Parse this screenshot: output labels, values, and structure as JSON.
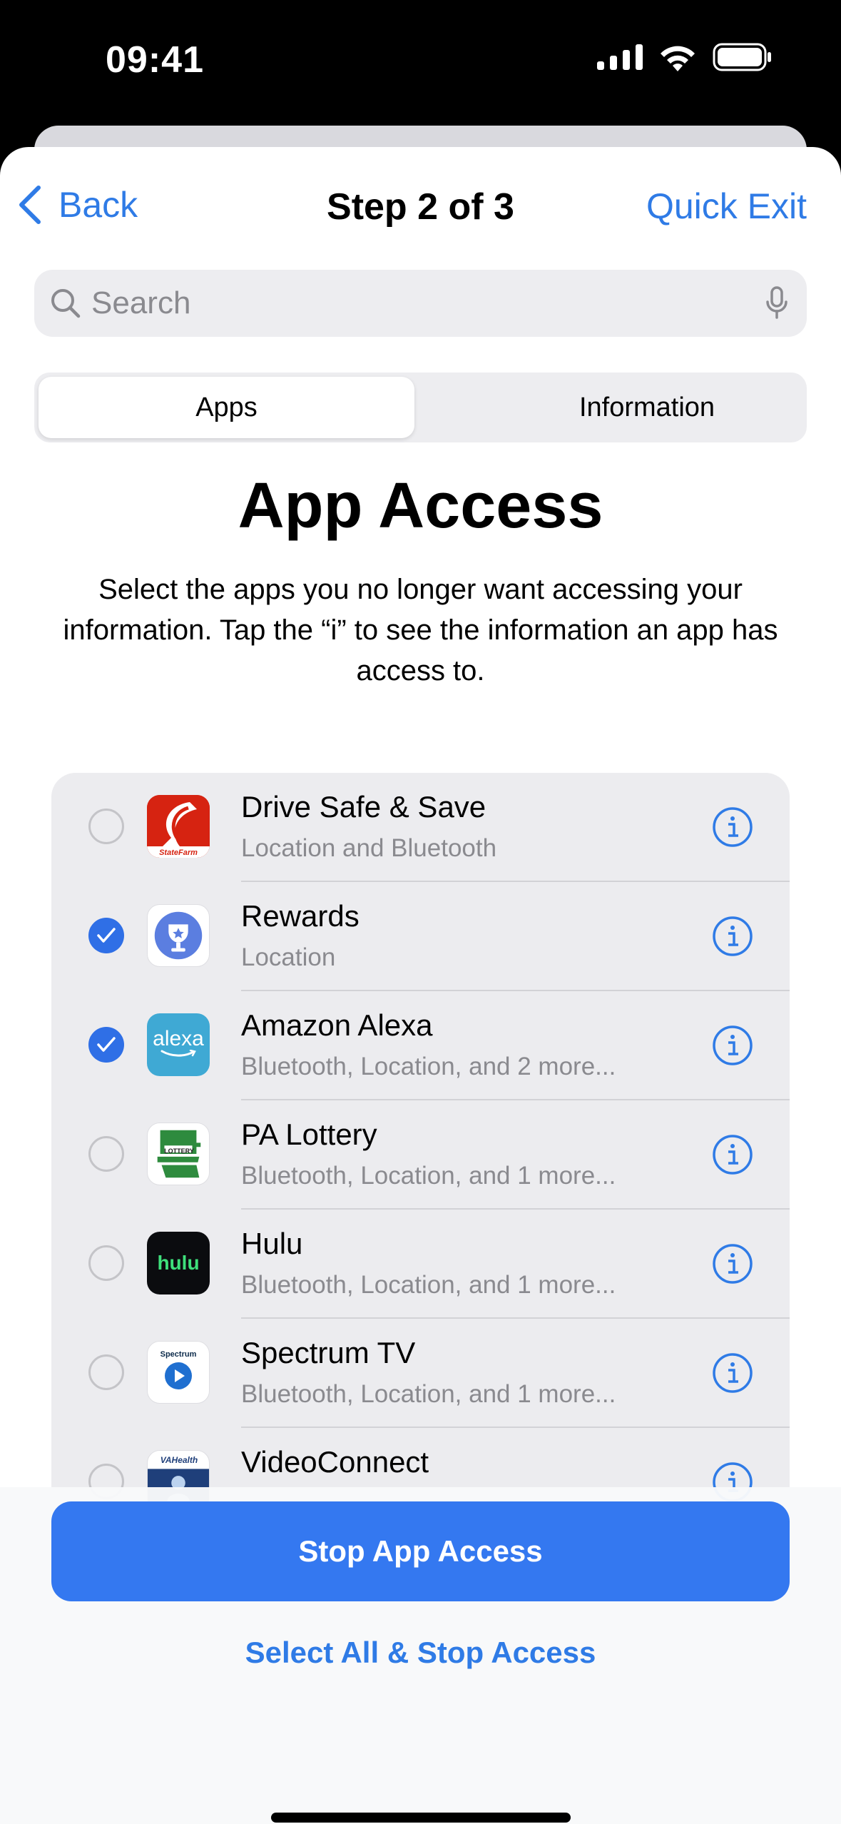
{
  "status_bar": {
    "time": "09:41"
  },
  "nav": {
    "back_label": "Back",
    "title": "Step 2 of 3",
    "quick_exit_label": "Quick Exit"
  },
  "search": {
    "placeholder": "Search"
  },
  "segments": {
    "apps": "Apps",
    "information": "Information",
    "selected": "Apps"
  },
  "heading": "App Access",
  "description": "Select the apps you no longer want accessing your information. Tap the “i” to see the information an app has access to.",
  "apps": [
    {
      "name": "Drive Safe & Save",
      "access": "Location and Bluetooth",
      "checked": false,
      "icon": "state-farm-icon",
      "icon_text": "StateFarm"
    },
    {
      "name": "Rewards",
      "access": "Location",
      "checked": true,
      "icon": "rewards-trophy-icon"
    },
    {
      "name": "Amazon Alexa",
      "access": "Bluetooth, Location, and 2 more...",
      "checked": true,
      "icon": "alexa-icon",
      "icon_text": "alexa"
    },
    {
      "name": "PA Lottery",
      "access": "Bluetooth, Location, and 1 more...",
      "checked": false,
      "icon": "pa-lottery-icon",
      "icon_text": "LOTTERY"
    },
    {
      "name": "Hulu",
      "access": "Bluetooth, Location, and 1 more...",
      "checked": false,
      "icon": "hulu-icon",
      "icon_text": "hulu"
    },
    {
      "name": "Spectrum TV",
      "access": "Bluetooth, Location, and 1 more...",
      "checked": false,
      "icon": "spectrum-icon",
      "icon_text": "Spectrum"
    },
    {
      "name": "VideoConnect",
      "access": "",
      "checked": false,
      "icon": "va-health-icon",
      "icon_text": "VAHealth"
    }
  ],
  "actions": {
    "primary": "Stop App Access",
    "secondary": "Select All & Stop Access"
  },
  "colors": {
    "accent": "#2f7be6",
    "primary_button": "#3478f0",
    "checkbox": "#2f6fe6"
  }
}
